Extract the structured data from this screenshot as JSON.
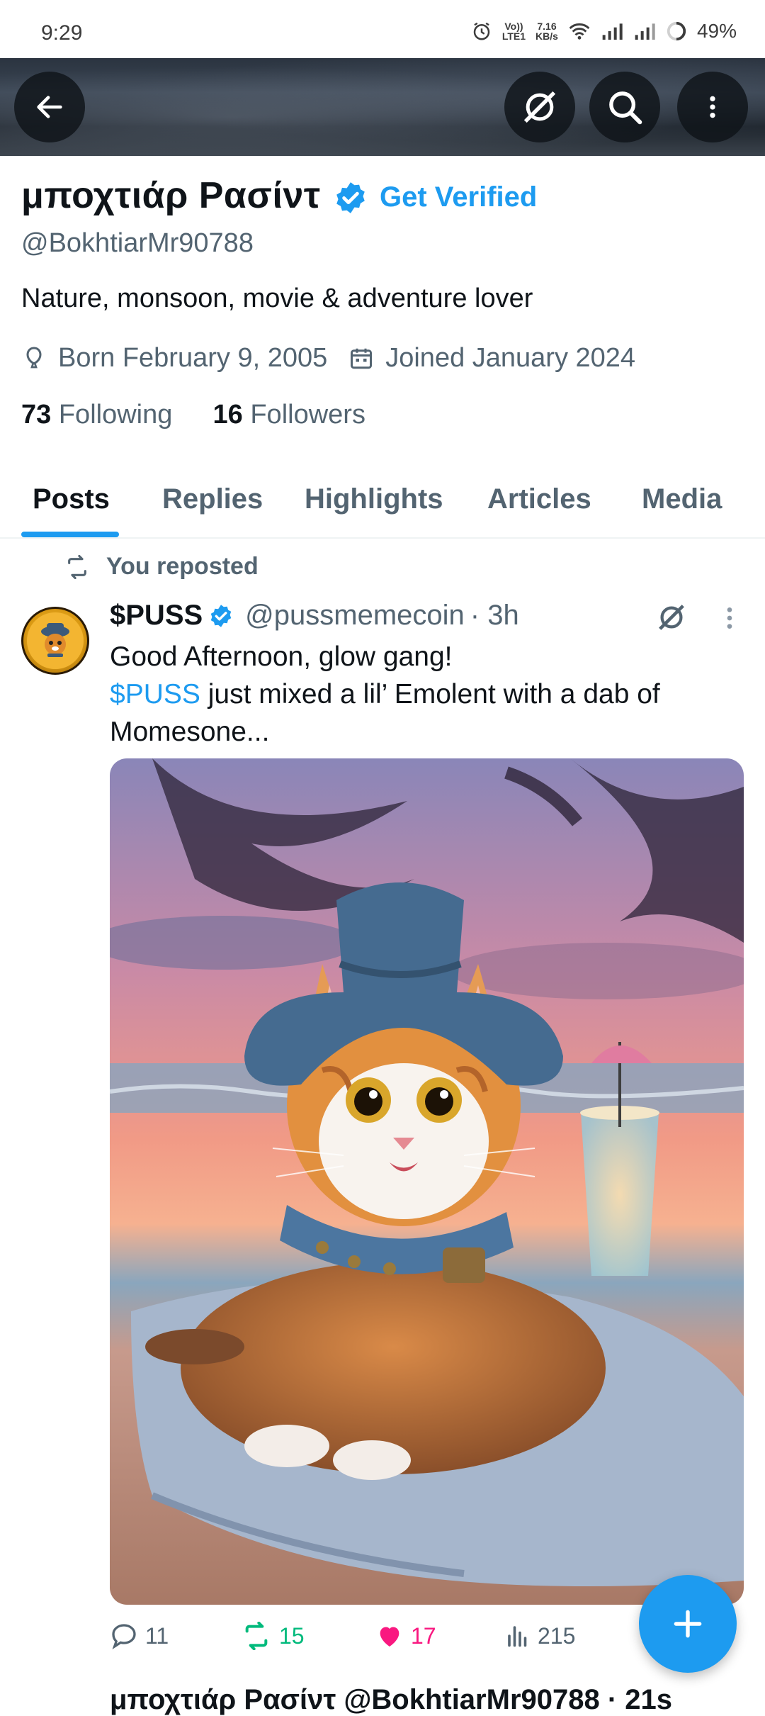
{
  "status_bar": {
    "time": "9:29",
    "net_top": "Vo))",
    "net_bottom": "LTE1",
    "speed_top": "7.16",
    "speed_bottom": "KB/s",
    "battery": "49%"
  },
  "profile": {
    "name": "μποχτιάρ Ρασίντ",
    "get_verified_label": "Get Verified",
    "handle": "@BokhtiarMr90788",
    "bio": "Nature, monsoon, movie & adventure lover",
    "born": "Born February 9, 2005",
    "joined": "Joined January 2024",
    "following_count": "73",
    "following_label": "Following",
    "followers_count": "16",
    "followers_label": "Followers"
  },
  "tabs": [
    {
      "label": "Posts",
      "active": true
    },
    {
      "label": "Replies"
    },
    {
      "label": "Highlights"
    },
    {
      "label": "Articles"
    },
    {
      "label": "Media"
    }
  ],
  "post": {
    "repost_label": "You reposted",
    "author_name": "$PUSS",
    "author_handle": "@pussmemecoin",
    "time": "· 3h",
    "line1": "Good Afternoon, glow gang!",
    "cashtag": "$PUSS",
    "line2_rest": " just mixed a lil’ Emolent with a dab of",
    "line3": "Momesone...",
    "replies": "11",
    "reposts": "15",
    "likes": "17",
    "views": "215"
  },
  "next_post_preview": "μποχτιάρ Ρασίντ @BokhtiarMr90788 · 21s",
  "colors": {
    "accent": "#1d9bf0",
    "repost_green": "#00ba7c",
    "like_pink": "#f91880",
    "secondary_text": "#536471"
  }
}
